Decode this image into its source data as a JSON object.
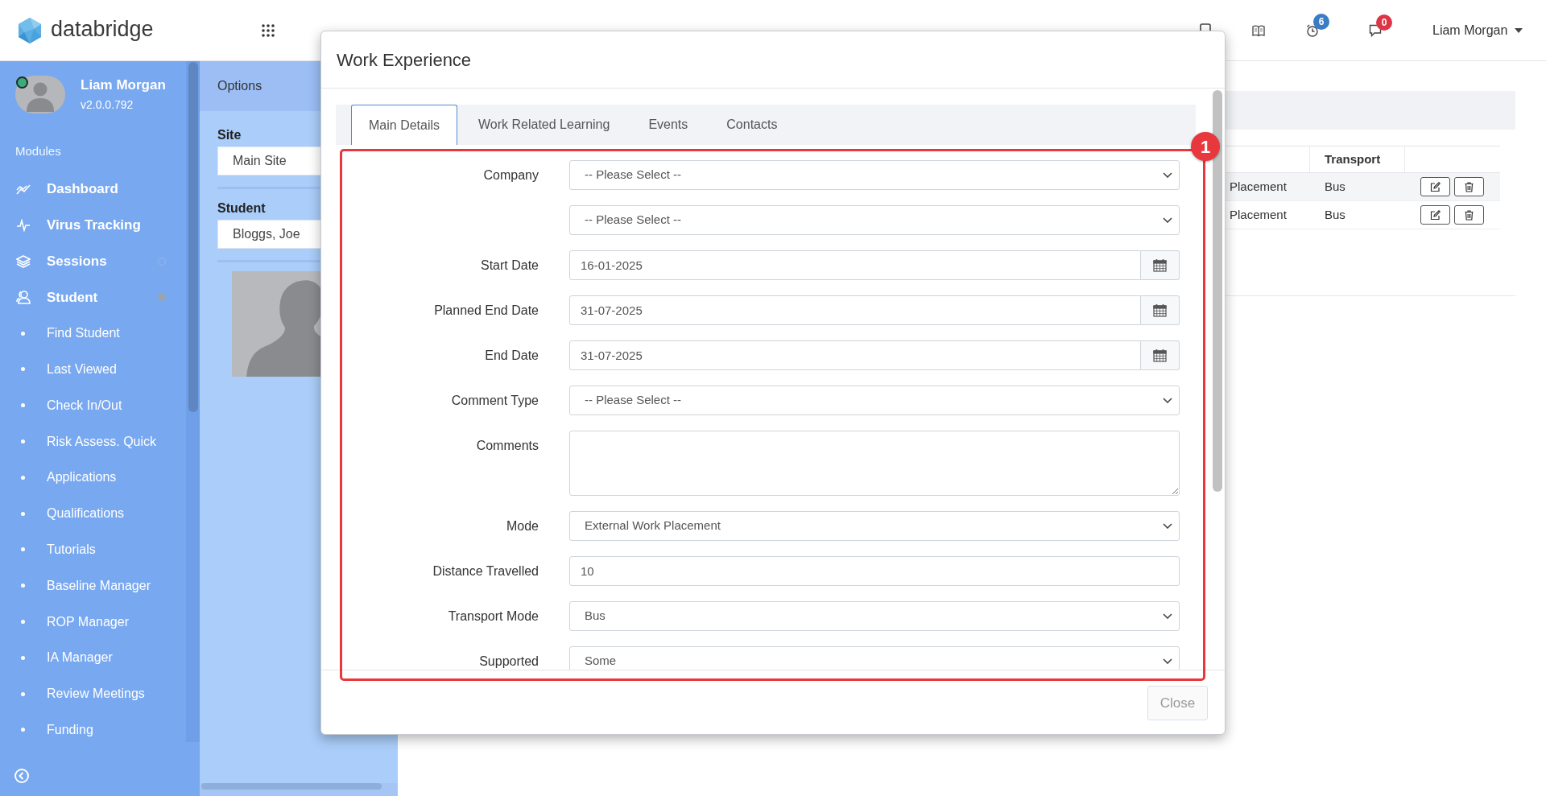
{
  "header": {
    "brand": "databridge",
    "notifications": [
      {
        "count": "6",
        "color": "#3b7cc6"
      },
      {
        "count": "0",
        "color": "#dc3545"
      }
    ],
    "user": "Liam Morgan"
  },
  "sidebar": {
    "profile": {
      "name": "Liam Morgan",
      "version": "v2.0.0.792",
      "online": true
    },
    "section": "Modules",
    "items": [
      {
        "label": "Dashboard",
        "kind": "link"
      },
      {
        "label": "Virus Tracking",
        "kind": "link"
      },
      {
        "label": "Sessions",
        "kind": "group",
        "expanded": false
      },
      {
        "label": "Student",
        "kind": "group",
        "expanded": true,
        "children": [
          {
            "label": "Find Student"
          },
          {
            "label": "Last Viewed"
          },
          {
            "label": "Check In/Out"
          },
          {
            "label": "Risk Assess. Quick"
          },
          {
            "label": "Applications"
          },
          {
            "label": "Qualifications"
          },
          {
            "label": "Tutorials"
          },
          {
            "label": "Baseline Manager"
          },
          {
            "label": "ROP Manager"
          },
          {
            "label": "IA Manager"
          },
          {
            "label": "Review Meetings"
          },
          {
            "label": "Funding"
          }
        ]
      }
    ]
  },
  "options_panel": {
    "title": "Options",
    "fields": [
      {
        "label": "Site",
        "value": "Main Site"
      },
      {
        "label": "Student",
        "value": "Bloggs, Joe"
      }
    ]
  },
  "table": {
    "columns": [
      "",
      "Transport"
    ],
    "rows": [
      {
        "cells": [
          "Placement",
          "Bus"
        ]
      },
      {
        "cells": [
          "Placement",
          "Bus"
        ]
      }
    ]
  },
  "modal": {
    "title": "Work Experience",
    "tabs": [
      {
        "label": "Main Details",
        "selected": true
      },
      {
        "label": "Work Related Learning",
        "selected": false
      },
      {
        "label": "Events",
        "selected": false
      },
      {
        "label": "Contacts",
        "selected": false
      }
    ],
    "fields": [
      {
        "kind": "select",
        "label": "Company",
        "value": "-- Please Select --"
      },
      {
        "kind": "select",
        "value": "-- Please Select --"
      },
      {
        "kind": "date",
        "label": "Start Date",
        "value": "16-01-2025"
      },
      {
        "kind": "date",
        "label": "Planned End Date",
        "value": "31-07-2025"
      },
      {
        "kind": "date",
        "label": "End Date",
        "value": "31-07-2025"
      },
      {
        "kind": "select",
        "label": "Comment Type",
        "value": "-- Please Select --"
      },
      {
        "kind": "textarea",
        "label": "Comments"
      },
      {
        "kind": "select",
        "label": "Mode",
        "value": "External Work Placement"
      },
      {
        "kind": "text",
        "label": "Distance Travelled",
        "value": "10"
      },
      {
        "kind": "select",
        "label": "Transport Mode",
        "value": "Bus"
      },
      {
        "kind": "select",
        "label": "Supported",
        "value": "Some"
      }
    ],
    "buttons": [
      {
        "label": "Close"
      }
    ]
  },
  "annotation": {
    "number": "1"
  }
}
